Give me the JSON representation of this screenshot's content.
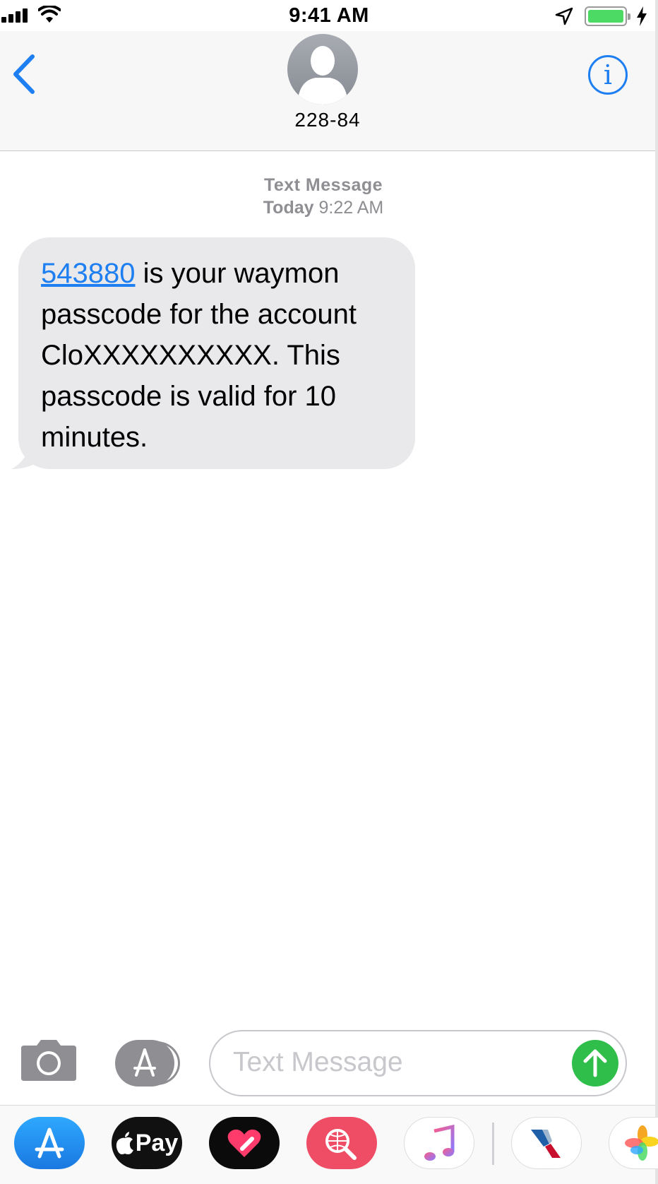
{
  "status_bar": {
    "time": "9:41 AM",
    "battery_level": 1.0,
    "icons": [
      "signal-icon",
      "wifi-icon",
      "location-icon",
      "battery-icon",
      "charging-icon"
    ]
  },
  "header": {
    "contact": "228-84",
    "icons": [
      "back-chevron-icon",
      "contact-avatar-icon",
      "info-icon"
    ],
    "info_glyph": "i"
  },
  "conversation": {
    "service_label": "Text Message",
    "timestamp_day": "Today",
    "timestamp_time": "9:22 AM",
    "messages": [
      {
        "direction": "incoming",
        "code": "543880",
        "text": " is your waymon passcode for the account CloXXXXXXXXXX. This passcode is valid for 10 minutes."
      }
    ]
  },
  "composer": {
    "placeholder": "Text Message",
    "icons": [
      "camera-icon",
      "app-store-icon",
      "send-arrow-icon"
    ]
  },
  "app_drawer": {
    "apps": [
      {
        "name": "App Store",
        "icon": "app-store-icon"
      },
      {
        "name": "Apple Pay",
        "icon": "apple-pay-icon",
        "label": "Pay"
      },
      {
        "name": "Digital Touch",
        "icon": "digital-touch-heart-icon"
      },
      {
        "name": "Images Search",
        "icon": "globe-search-icon"
      },
      {
        "name": "Music",
        "icon": "music-note-icon"
      },
      {
        "name": "American Airlines",
        "icon": "american-airlines-icon"
      },
      {
        "name": "Photos",
        "icon": "photos-pinwheel-icon"
      }
    ],
    "colors": {
      "accent_blue": "#1e7ff2",
      "send_green": "#2fbe4a",
      "bubble_gray": "#e9e9eb",
      "battery_green": "#4cd964"
    }
  }
}
